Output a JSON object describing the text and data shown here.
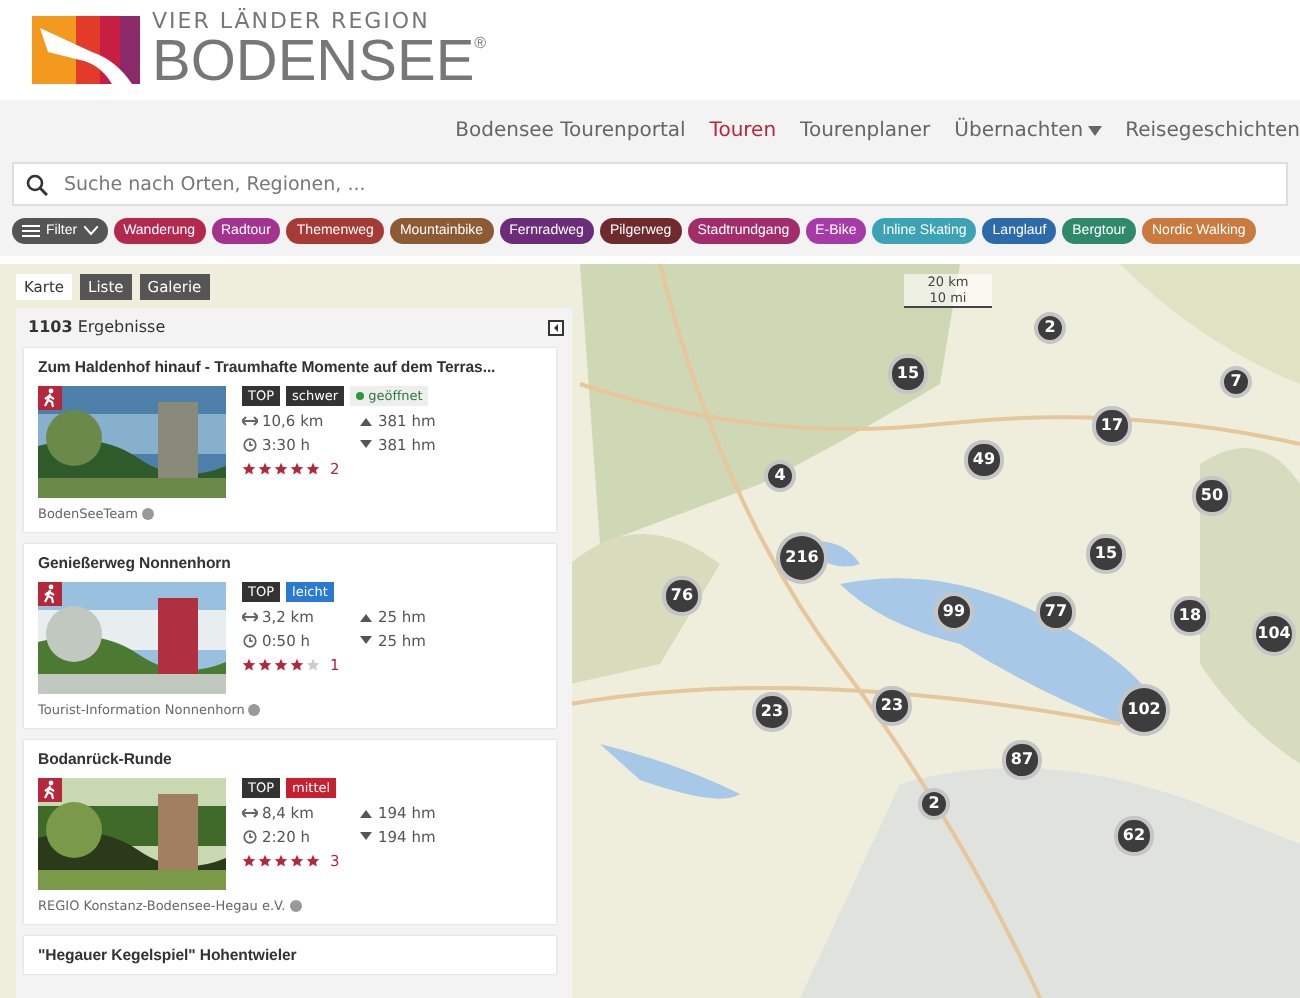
{
  "logo": {
    "tagline": "VIER LÄNDER REGION",
    "name": "BODENSEE",
    "mark": "®"
  },
  "nav": [
    {
      "label": "Bodensee Tourenportal",
      "selected": false,
      "dropdown": false
    },
    {
      "label": "Touren",
      "selected": true,
      "dropdown": false
    },
    {
      "label": "Tourenplaner",
      "selected": false,
      "dropdown": false
    },
    {
      "label": "Übernachten",
      "selected": false,
      "dropdown": true
    },
    {
      "label": "Reisegeschichten",
      "selected": false,
      "dropdown": false
    }
  ],
  "search": {
    "placeholder": "Suche nach Orten, Regionen, ..."
  },
  "filter": {
    "label": "Filter"
  },
  "categories": [
    {
      "label": "Wanderung",
      "color": "#b3294e"
    },
    {
      "label": "Radtour",
      "color": "#a3338f"
    },
    {
      "label": "Themenweg",
      "color": "#a63b36"
    },
    {
      "label": "Mountainbike",
      "color": "#8c5a33"
    },
    {
      "label": "Fernradweg",
      "color": "#6b2c7a"
    },
    {
      "label": "Pilgerweg",
      "color": "#6e2a2c"
    },
    {
      "label": "Stadtrundgang",
      "color": "#a32d6b"
    },
    {
      "label": "E-Bike",
      "color": "#a63ba8"
    },
    {
      "label": "Inline Skating",
      "color": "#3ca3b5"
    },
    {
      "label": "Langlauf",
      "color": "#2d6aaa"
    },
    {
      "label": "Bergtour",
      "color": "#2e8a6b"
    },
    {
      "label": "Nordic Walking",
      "color": "#c97a3c"
    }
  ],
  "views": [
    {
      "label": "Karte",
      "selected": true
    },
    {
      "label": "Liste",
      "selected": false
    },
    {
      "label": "Galerie",
      "selected": false
    }
  ],
  "results": {
    "count": "1103",
    "label": "Ergebnisse"
  },
  "tours": [
    {
      "title": "Zum Haldenhof hinauf - Traumhafte Momente auf dem Terras...",
      "top": "TOP",
      "difficulty": "schwer",
      "color": "#333333",
      "status": "geöffnet",
      "distance": "10,6 km",
      "duration": "3:30 h",
      "ascent": "381 hm",
      "descent": "381 hm",
      "stars": 5,
      "reviews": "2",
      "author": "BodenSeeTeam"
    },
    {
      "title": "Genießerweg Nonnenhorn",
      "top": "TOP",
      "difficulty": "leicht",
      "color": "#2a7ad1",
      "distance": "3,2 km",
      "duration": "0:50 h",
      "ascent": "25 hm",
      "descent": "25 hm",
      "stars": 4,
      "reviews": "1",
      "author": "Tourist-Information Nonnenhorn"
    },
    {
      "title": "Bodanrück-Runde",
      "top": "TOP",
      "difficulty": "mittel",
      "color": "#c8202e",
      "distance": "8,4 km",
      "duration": "2:20 h",
      "ascent": "194 hm",
      "descent": "194 hm",
      "stars": 5,
      "reviews": "3",
      "author": "REGIO Konstanz-Bodensee-Hegau e.V."
    },
    {
      "title": "\"Hegauer Kegelspiel\" Hohentwieler"
    }
  ],
  "scale": {
    "metric": "20 km",
    "imperial": "10 mi"
  },
  "clusters": [
    "2",
    "15",
    "7",
    "17",
    "4",
    "49",
    "50",
    "216",
    "15",
    "76",
    "99",
    "77",
    "18",
    "104",
    "23",
    "23",
    "102",
    "87",
    "2",
    "62"
  ]
}
